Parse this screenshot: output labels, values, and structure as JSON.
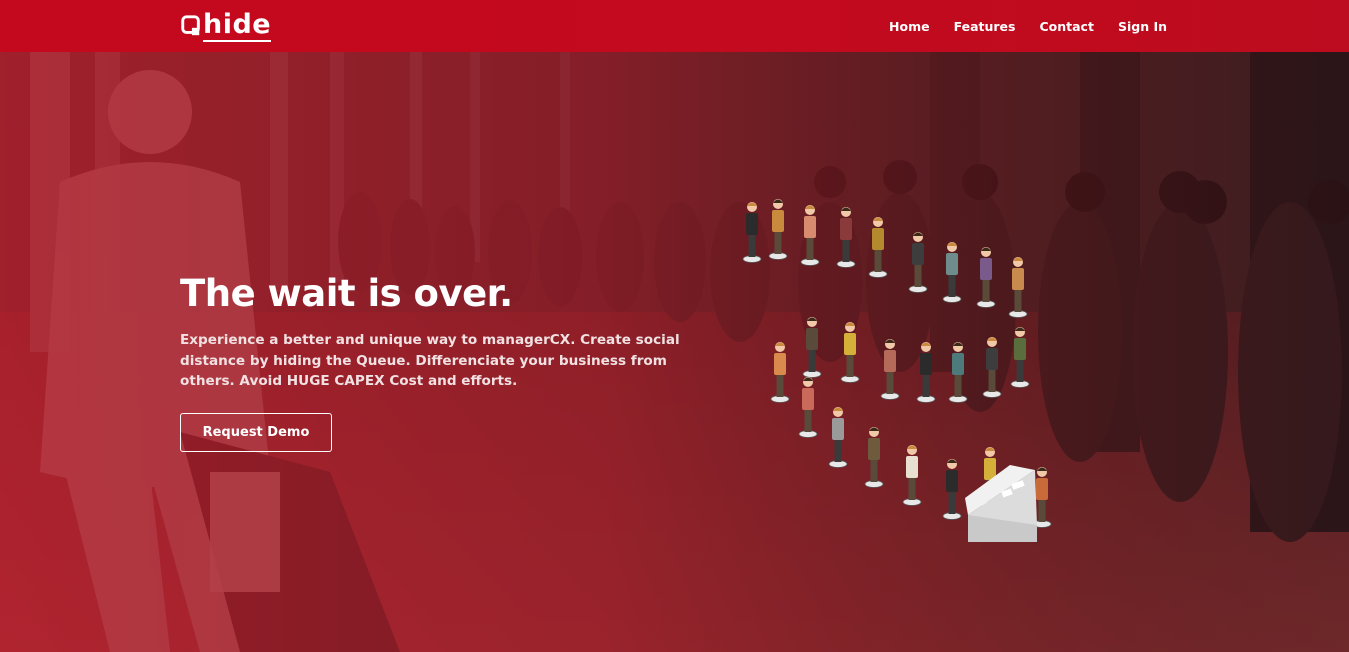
{
  "brand": {
    "name": "hide",
    "mark_letter": "Q"
  },
  "nav": {
    "items": [
      "Home",
      "Features",
      "Contact",
      "Sign In"
    ]
  },
  "hero": {
    "headline": "The wait is over.",
    "subtitle": "Experience a better and unique way to managerCX. Create social distance by hiding the Queue. Differenciate your business from others. Avoid HUGE CAPEX Cost and efforts.",
    "cta_label": "Request Demo"
  },
  "colors": {
    "header_red": "#c4081d",
    "overlay_red": "#a31a25",
    "text_white": "#ffffff"
  }
}
